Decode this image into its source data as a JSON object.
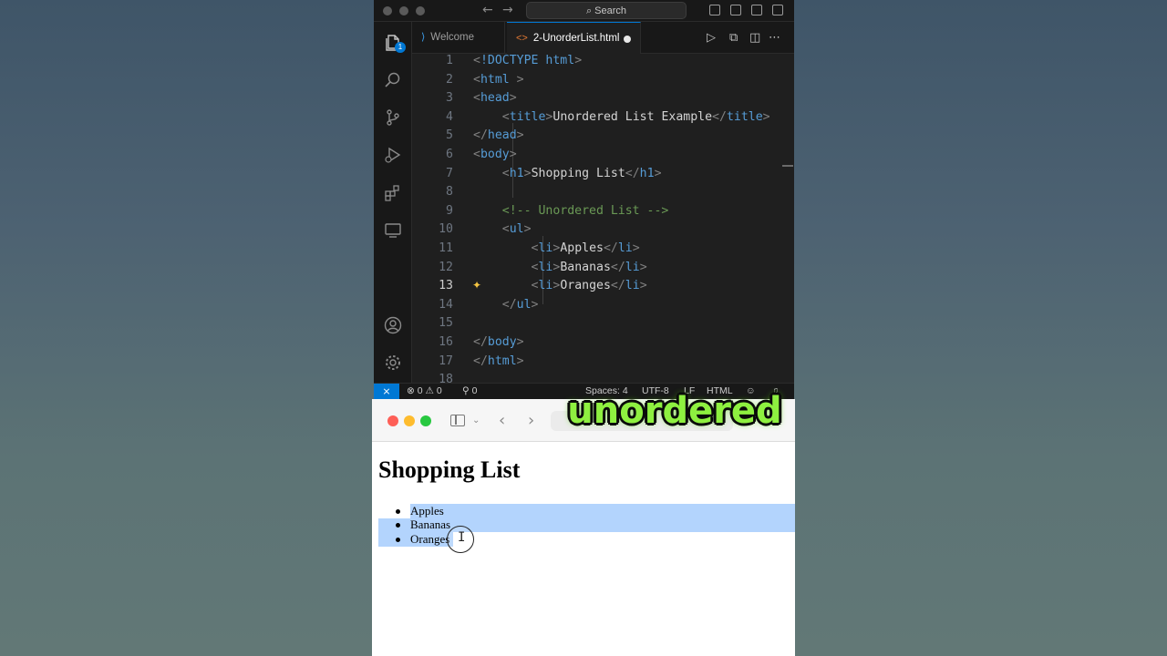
{
  "vscode": {
    "search_label": "Search",
    "activity_badge": "1",
    "tabs": [
      {
        "label": "Welcome",
        "active": false
      },
      {
        "label": "2-UnorderList.html",
        "active": true,
        "modified": true
      }
    ],
    "code_lines": [
      {
        "n": "1",
        "text": "<!DOCTYPE html>"
      },
      {
        "n": "2",
        "text": "<html >"
      },
      {
        "n": "3",
        "text": "<head>"
      },
      {
        "n": "4",
        "text": "    <title>Unordered List Example</title>"
      },
      {
        "n": "5",
        "text": "</head>"
      },
      {
        "n": "6",
        "text": "<body>"
      },
      {
        "n": "7",
        "text": "    <h1>Shopping List</h1>"
      },
      {
        "n": "8",
        "text": ""
      },
      {
        "n": "9",
        "text": "    <!-- Unordered List -->"
      },
      {
        "n": "10",
        "text": "    <ul>"
      },
      {
        "n": "11",
        "text": "        <li>Apples</li>"
      },
      {
        "n": "12",
        "text": "        <li>Bananas</li>"
      },
      {
        "n": "13",
        "text": "        <li>Oranges</li>"
      },
      {
        "n": "14",
        "text": "    </ul>"
      },
      {
        "n": "15",
        "text": ""
      },
      {
        "n": "16",
        "text": "</body>"
      },
      {
        "n": "17",
        "text": "</html>"
      },
      {
        "n": "18",
        "text": ""
      }
    ],
    "current_line": "13",
    "status": {
      "errors": "0",
      "warnings": "0",
      "ports": "0",
      "spaces": "Spaces: 4",
      "encoding": "UTF-8",
      "eol": "LF",
      "language": "HTML"
    }
  },
  "browser": {
    "page_heading": "Shopping List",
    "list_items": [
      "Apples",
      "Bananas",
      "Oranges"
    ]
  },
  "overlay_caption": "unordered",
  "colors": {
    "accent_blue": "#0078d4",
    "selection": "#b3d4fd",
    "caption_green": "#8ef040"
  }
}
